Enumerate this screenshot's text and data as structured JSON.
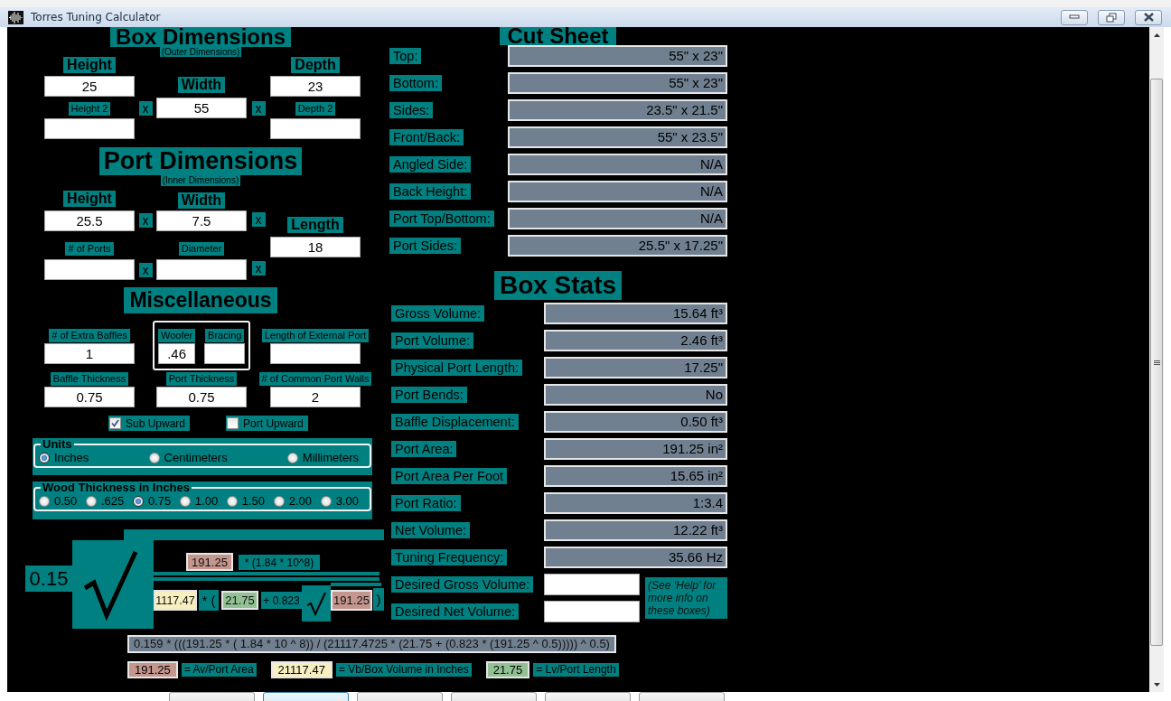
{
  "window": {
    "title": "Torres Tuning Calculator"
  },
  "box_dimensions": {
    "heading": "Box Dimensions",
    "subheading": "(Outer Dimensions)",
    "fields": [
      {
        "kind": "main",
        "label": "Height",
        "value": "25"
      },
      {
        "kind": "main",
        "label": "Width",
        "value": "55"
      },
      {
        "kind": "main",
        "label": "Depth",
        "value": "23"
      },
      {
        "kind": "minor",
        "label": "Height 2"
      },
      {
        "kind": "minor",
        "label": "Depth 2"
      }
    ],
    "separators": [
      "x",
      "x"
    ]
  },
  "port_dimensions": {
    "heading": "Port Dimensions",
    "subheading": "(Inner Dimensions)",
    "fields": [
      {
        "kind": "main",
        "label": "Height",
        "value": "25.5"
      },
      {
        "kind": "main",
        "label": "Width",
        "value": "7.5"
      },
      {
        "kind": "minor",
        "label": "# of Ports"
      },
      {
        "kind": "minor",
        "label": "Diameter"
      },
      {
        "kind": "main",
        "label": "Length",
        "value": "18"
      }
    ],
    "separators": [
      "x",
      "x",
      "x",
      "x"
    ]
  },
  "miscellaneous": {
    "heading": "Miscellaneous",
    "fields": [
      {
        "kind": "minor",
        "label": "# of Extra Baffles",
        "value": "1"
      },
      {
        "kind": "minor",
        "label": "Woofer",
        "value": ".46"
      },
      {
        "kind": "minor",
        "label": "Bracing"
      },
      {
        "kind": "minor",
        "label": "Length of External Port"
      },
      {
        "kind": "minor",
        "label": "Baffle Thickness",
        "value": "0.75"
      },
      {
        "kind": "minor",
        "label": "Port Thickness",
        "value": "0.75"
      },
      {
        "kind": "minor",
        "label": "# of Common Port Walls",
        "value": "2"
      }
    ],
    "checkboxes": [
      {
        "label": "Sub Upward",
        "checked": true
      },
      {
        "label": "Port Upward",
        "checked": false
      }
    ]
  },
  "units": {
    "title": "Units",
    "options": [
      {
        "label": "Inches",
        "selected": true
      },
      {
        "label": "Centimeters",
        "selected": false
      },
      {
        "label": "Millimeters",
        "selected": false
      }
    ]
  },
  "wood_thickness": {
    "title": "Wood Thickness in Inches",
    "options": [
      {
        "label": "0.50",
        "selected": false
      },
      {
        "label": ".625",
        "selected": false
      },
      {
        "label": "0.75",
        "selected": true
      },
      {
        "label": "1.00",
        "selected": false
      },
      {
        "label": "1.50",
        "selected": false
      },
      {
        "label": "2.00",
        "selected": false
      },
      {
        "label": "3.00",
        "selected": false
      }
    ]
  },
  "formula": {
    "coefficient": "0.15",
    "port_area": "191.25",
    "numerator_factor": "* (1.84 * 10^8)",
    "box_volume": "1117.47",
    "open_paren": "* (",
    "port_length": "21.75",
    "plus_term": "+ 0.823",
    "root_port_area": "191.25",
    "close_paren": ")",
    "expression": "0.159 * (((191.25 * ( 1.84 * 10 ^ 8)) / (21117.4725 * (21.75 + (0.823 * (191.25 ^ 0.5))))) ^ 0.5)",
    "legend": [
      {
        "value": "191.25",
        "label": "= Av/Port Area",
        "color": "#c4968d"
      },
      {
        "value": "21117.47",
        "label": "= Vb/Box Volume in Inches",
        "color": "#f7efbf"
      },
      {
        "value": "21.75",
        "label": "= Lv/Port Length",
        "color": "#92c294"
      }
    ]
  },
  "cut_sheet": {
    "heading": "Cut Sheet",
    "rows": [
      {
        "label": "Top:",
        "value": "55\" x 23\""
      },
      {
        "label": "Bottom:",
        "value": "55\" x 23\""
      },
      {
        "label": "Sides:",
        "value": "23.5\" x 21.5\""
      },
      {
        "label": "Front/Back:",
        "value": "55\" x 23.5\""
      },
      {
        "label": "Angled Side:",
        "value": "N/A"
      },
      {
        "label": "Back Height:",
        "value": "N/A"
      },
      {
        "label": "Port Top/Bottom:",
        "value": "N/A"
      },
      {
        "label": "Port Sides:",
        "value": "25.5\" x 17.25\""
      }
    ]
  },
  "box_stats": {
    "heading": "Box Stats",
    "rows": [
      {
        "label": "Gross Volume:",
        "value": "15.64 ft³"
      },
      {
        "label": "Port Volume:",
        "value": "2.46 ft³"
      },
      {
        "label": "Physical Port Length:",
        "value": "17.25\""
      },
      {
        "label": "Port Bends:",
        "value": "No"
      },
      {
        "label": "Baffle Displacement:",
        "value": "0.50 ft³"
      },
      {
        "label": "Port Area:",
        "value": "191.25 in²"
      },
      {
        "label": "Port Area Per Foot",
        "value": "15.65 in²"
      },
      {
        "label": "Port Ratio:",
        "value": "1:3.4"
      },
      {
        "label": "Net Volume:",
        "value": "12.22 ft³"
      },
      {
        "label": "Tuning Frequency:",
        "value": "35.66 Hz"
      }
    ],
    "inputs": [
      {
        "label": "Desired Gross Volume:"
      },
      {
        "label": "Desired Net Volume:"
      }
    ],
    "note": "(See ‘Help’ for more info on these boxes)"
  },
  "footer_buttons": [
    {
      "focused": false
    },
    {
      "focused": true
    },
    {
      "focused": false
    },
    {
      "focused": false
    },
    {
      "focused": false
    },
    {
      "focused": false
    }
  ]
}
